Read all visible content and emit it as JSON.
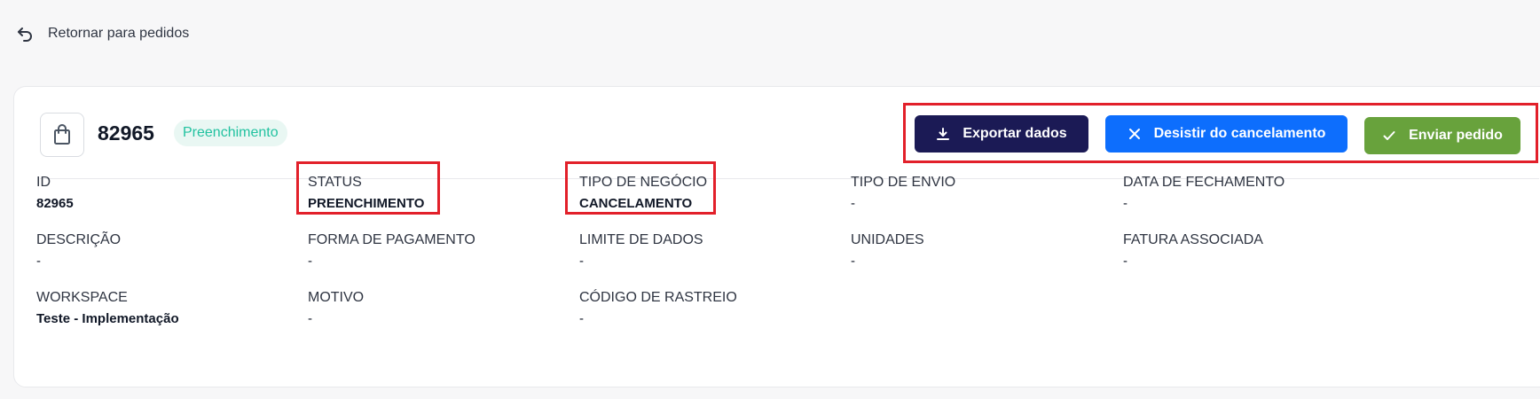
{
  "back": {
    "label": "Retornar para pedidos"
  },
  "order": {
    "id": "82965",
    "status_badge": "Preenchimento"
  },
  "actions": {
    "export_label": "Exportar dados",
    "cancel_label": "Desistir do cancelamento",
    "send_label": "Enviar pedido"
  },
  "fields": [
    {
      "label": "ID",
      "value": "82965"
    },
    {
      "label": "STATUS",
      "value": "PREENCHIMENTO"
    },
    {
      "label": "TIPO DE NEGÓCIO",
      "value": "CANCELAMENTO"
    },
    {
      "label": "TIPO DE ENVIO",
      "value": "-"
    },
    {
      "label": "DATA DE FECHAMENTO",
      "value": "-"
    },
    {
      "label": "DESCRIÇÃO",
      "value": "-"
    },
    {
      "label": "FORMA DE PAGAMENTO",
      "value": "-"
    },
    {
      "label": "LIMITE DE DADOS",
      "value": "-"
    },
    {
      "label": "UNIDADES",
      "value": "-"
    },
    {
      "label": "FATURA ASSOCIADA",
      "value": "-"
    },
    {
      "label": "WORKSPACE",
      "value": "Teste - Implementação"
    },
    {
      "label": "MOTIVO",
      "value": "-"
    },
    {
      "label": "CÓDIGO DE RASTREIO",
      "value": "-"
    }
  ],
  "colors": {
    "export_button": "#1b1a55",
    "cancel_button": "#0d6efd",
    "send_button": "#68a23c",
    "status_badge_text": "#22c2a0",
    "highlight": "#e2202a"
  },
  "icons": {
    "back": "undo-arrow-icon",
    "order": "shopping-bag-icon",
    "export": "download-icon",
    "cancel": "close-icon",
    "send": "check-icon"
  }
}
